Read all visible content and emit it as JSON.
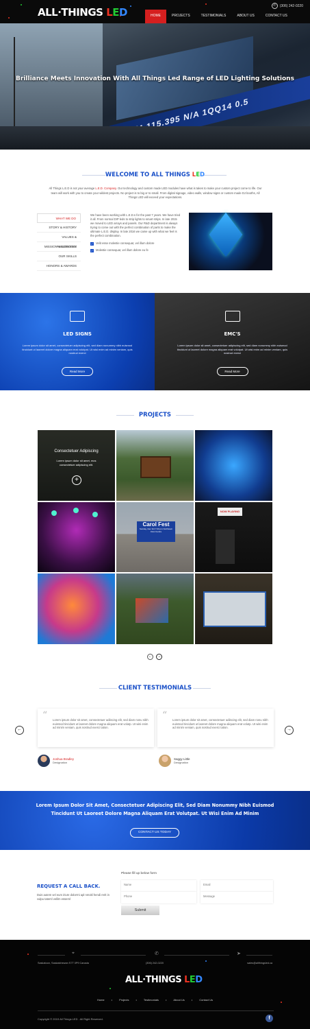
{
  "header": {
    "logo": {
      "word1": "ALL·THINGS ",
      "L": "L",
      "E": "E",
      "D": "D"
    },
    "phone": "(306) 242-0220",
    "nav": [
      "HOME",
      "PROJECTS",
      "TESTIMONIALS",
      "ABOUT US",
      "CONTACT US"
    ]
  },
  "hero": {
    "title": "Brilliance Meets Innovation With All Things Led Range of LED Lighting Solutions",
    "ticker": "1PM/4 115.395 N/A    1QQ14 0.5"
  },
  "welcome": {
    "title_a": "WELCOME TO ALL THINGS ",
    "title_L": "L",
    "title_E": "E",
    "title_D": "D",
    "intro_a": "All Things L.E.D is not your average ",
    "intro_red": "L.E.D. Company",
    "intro_b": ". Our technology and custom made LED modules have what is takes to make your custom project come to life. Our team will work with you to create your wildest projects. No project is to big or to small. From digital signage, video walls, window signs or custom made DJ booths, All Things LED will exceed your expectations.",
    "menu": [
      "WHAT WE DO",
      "STORY & HISTORY",
      "VALUES & PHILOSOPHY",
      "MISSION & SERVICES",
      "OUR SKILLS",
      "HONORS & AWARDS"
    ],
    "about": "We have been working with L.E.D.s for the past 7 years. We have tried it all. From normal DIP leds to strip lights to smart strips. In late 2015 we moved to LED arrays and panels. Our R&D department is always trying to come out with the perfect combination of parts to make the ultimate L.E.D. display. In late 2016 we came up with what we feel is the perfect combination.",
    "checks": [
      "Velit esse molestie consequat, vel illum dolore",
      "Molestie consequat, vel illum dolore eu fe"
    ]
  },
  "services": [
    {
      "title": "LED SIGNS",
      "text": "Lorem ipsum dolor sit amet, consectetuer adipiscing elit, sed diam nonummy nibh euismod tincidunt ut laoreet dolore magna aliquam erat volutpat. Ut wisi enim ad minim veniam, quis nostrud exerci",
      "button": "Read More"
    },
    {
      "title": "EMC'S",
      "text": "Lorem ipsum dolor sit amet, consectetuer adipiscing elit, sed diam nonummy nibh euismod tincidunt ut laoreet dolore magna aliquam erat volutpat. Ut wisi enim ad minim veniam, quis nostrud exerci",
      "button": "Read More"
    }
  ],
  "projects": {
    "title": "PROJECTS",
    "overlay_title": "Consectetuer Adipiscing",
    "overlay_text": "Lorem ipsum dolor sit amet, mos consectetuer adipiscing elit.",
    "sign_title": "Carol Fest",
    "sign_text": "Sunday, Dec 3rd 7:00 pm Northtown Civic Centre",
    "now_playing": "NOW PLAYING",
    "prev": "←",
    "next": "→"
  },
  "testimonials": {
    "title": "CLIENT TESTIMONIALS",
    "items": [
      {
        "text": "Lorem ipsum dolor sit amet, consectetuer adiiscing elit, sed diam nonu nibh euismod tincidunt ut laoreet dolore magna aliquam erat volutp. Ut wisi enim ad minim veniam, quis nostrud exerci tation.",
        "name": "Joshua Bradley",
        "designation": "Designation"
      },
      {
        "text": "Lorem ipsum dolor sit amet, consectetuer adiiscing elit, sed diam nonu nibh euismod tincidunt ut laoreet dolore magna aliquam erat volutp. Ut wisi enim ad minim veniam, quis nostrud exerci tation.",
        "name": "Saggy Little",
        "designation": "Designation"
      }
    ]
  },
  "cta": {
    "text": "Lorem Ipsum Dolor Sit Amet, Consectetuer Adipiscing Elit, Sed Diam Nonummy Nibh Euismod Tincidunt Ut Laoreet Dolore Magna Aliquam Erat Volutpat. Ut Wisi Enim Ad Minim",
    "button": "CONTACT US TODAY"
  },
  "callback": {
    "title": "REQUEST A CALL BACK.",
    "text": "Duis autem vel eum iriure dolorrni apl nmokl hendi rerit in vulpu tateml velilm esseml",
    "form_label": "Please fill up below form",
    "name": "Name",
    "email": "Email",
    "phone": "Phone",
    "message": "Message",
    "submit": "Submit"
  },
  "footer": {
    "address": "Saskatoon, Saskatchewan S7T 0P9 Canada",
    "phone": "(306) 242-0220",
    "email": "sales@allthingsled.ca",
    "nav": [
      "Home",
      "Projects",
      "Testimonials",
      "About Us",
      "Contact Us"
    ],
    "copyright": "Copyright © 2019 All Things LED . All Right Reserved.",
    "facebook": "f"
  }
}
